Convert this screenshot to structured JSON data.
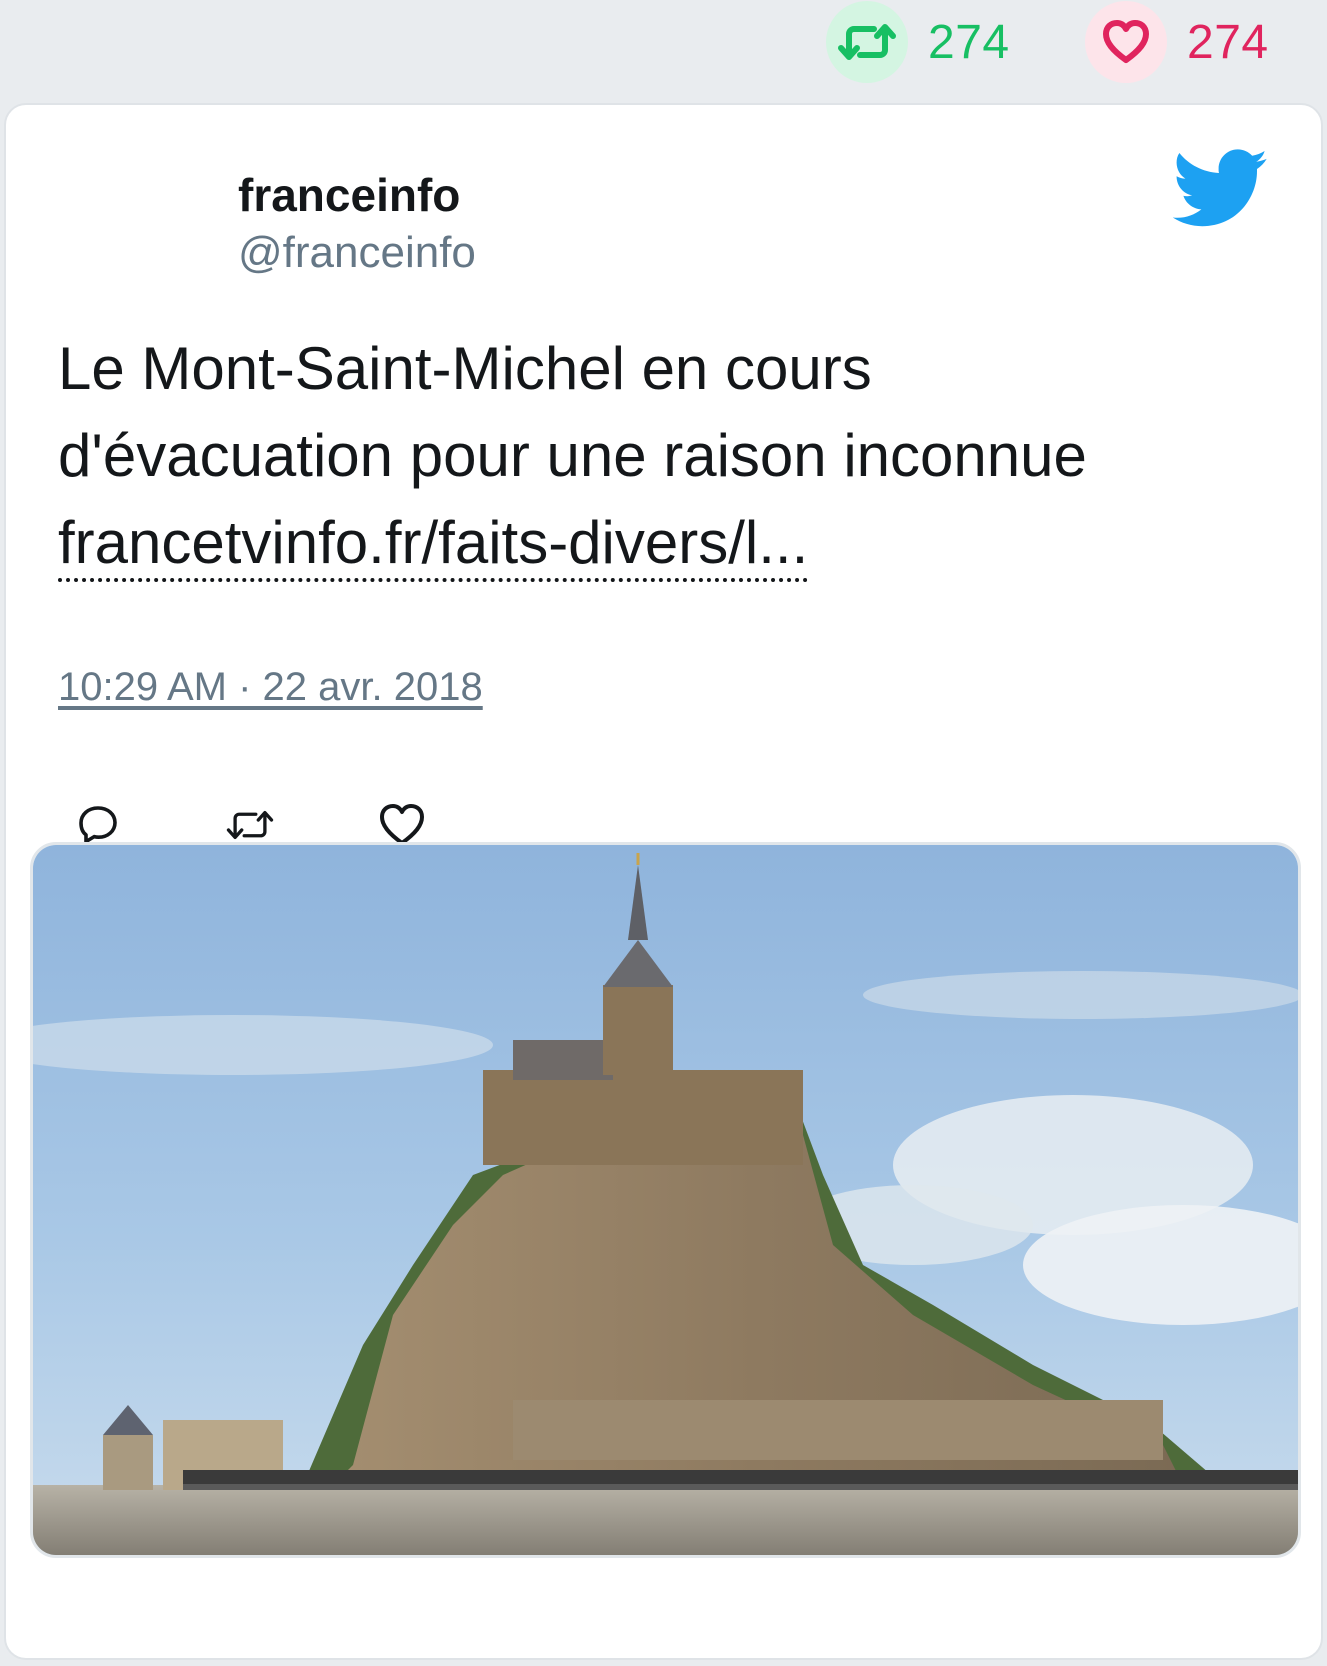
{
  "stats": {
    "retweets": "274",
    "likes": "274",
    "retweet_color": "#17bf63",
    "like_color": "#e0245e"
  },
  "tweet": {
    "author_name": "franceinfo",
    "author_handle": "@franceinfo",
    "text_line1": "Le Mont-Saint-Michel en cours",
    "text_line2": "d'évacuation pour une raison inconnue",
    "link_text": "francetvinfo.fr/faits-divers/l...",
    "timestamp": "10:29 AM · 22 avr. 2018",
    "brand_icon": "twitter-bird-icon",
    "brand_color": "#1da1f2"
  },
  "actions": [
    {
      "icon": "reply-icon"
    },
    {
      "icon": "retweet-icon"
    },
    {
      "icon": "like-icon"
    }
  ],
  "media": {
    "subject": "Mont-Saint-Michel photo"
  }
}
